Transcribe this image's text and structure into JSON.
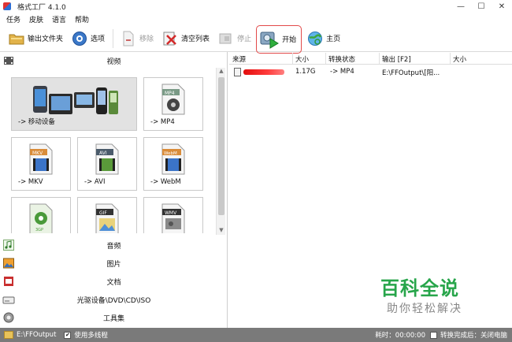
{
  "window": {
    "title": "格式工厂 4.1.0",
    "minimize": "—",
    "maximize": "☐",
    "close": "✕"
  },
  "menu": [
    "任务",
    "皮肤",
    "语言",
    "帮助"
  ],
  "toolbar": {
    "output_folder": "输出文件夹",
    "options": "选项",
    "remove": "移除",
    "clear_list": "清空列表",
    "stop": "停止",
    "start": "开始",
    "home": "主页"
  },
  "left": {
    "video_label": "视频",
    "tiles": [
      {
        "label": "-> 移动设备",
        "badge": ""
      },
      {
        "label": "-> MP4",
        "badge": "MP4"
      },
      {
        "label": "-> MKV",
        "badge": "MKV"
      },
      {
        "label": "-> AVI",
        "badge": "AVI"
      },
      {
        "label": "-> WebM",
        "badge": "WebM"
      },
      {
        "label": "",
        "badge": "3GP"
      },
      {
        "label": "",
        "badge": "GIF"
      },
      {
        "label": "",
        "badge": "WMV"
      }
    ],
    "audio_label": "音频",
    "image_label": "图片",
    "doc_label": "文档",
    "rom_label": "光驱设备\\DVD\\CD\\ISO",
    "tools_label": "工具集"
  },
  "table": {
    "headers": [
      "来源",
      "大小",
      "转换状态",
      "输出 [F2]",
      "大小"
    ],
    "rows": [
      {
        "source": "",
        "size": "1.17G",
        "status": "-> MP4",
        "output": "E:\\FFOutput\\[阳...",
        "out_size": ""
      }
    ]
  },
  "watermark": {
    "title": "百科全说",
    "subtitle": "助你轻松解决"
  },
  "status": {
    "output_path": "E:\\FFOutput",
    "multithread": "使用多线程",
    "elapsed": "耗时：00:00:00",
    "after_done": "转换完成后：关闭电脑"
  },
  "colors": {
    "accent_green": "#27a54a",
    "start_border": "#e24a4a",
    "status_bg": "#7a7a7a"
  }
}
